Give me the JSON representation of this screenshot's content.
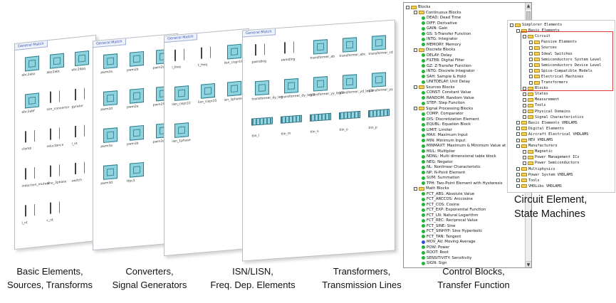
{
  "panels": [
    {
      "tab": "General Match",
      "labels": [
        "abc2abz",
        "abz2abc",
        "ebc2dpq",
        "abc2abf",
        "sim_converter",
        "gyrator",
        "clamp",
        "reluctance",
        "l_nt",
        "induction_mutual",
        "sine_3phase",
        "switch",
        "l_nt",
        "c_nt"
      ]
    },
    {
      "tab": "General Match",
      "labels": [
        "pwm2a",
        "pwm2b",
        "pwm2c",
        "pwm2d",
        "pwm2e",
        "pwm2f",
        "pwm3a",
        "pwm3b",
        "pwm3c",
        "pwm3d",
        "tfpc3"
      ]
    },
    {
      "tab": "General Match",
      "labels": [
        "l_freq",
        "t_freq",
        "lisn_cispr16",
        "lisn_cispr22",
        "lisn_cispr25",
        "isn_3phase",
        "lisn_1phase"
      ]
    },
    {
      "tab": "General Match",
      "labels": [
        "pwinding",
        "swinding",
        "transformer_ab",
        "transformer_abc",
        "transformer_cd",
        "transformer_dy_leg",
        "transformer_dy_leg3l",
        "transformer_yy_leg3l",
        "transformer_yd_leg3l",
        "transformer_yy",
        "tlin_l",
        "tlin_m",
        "tlin_n",
        "tlin_o",
        "tlin_p"
      ]
    }
  ],
  "captions": [
    {
      "line1": "Basic Elements,",
      "line2": "Sources, Transforms"
    },
    {
      "line1": "Converters,",
      "line2": "Signal Generators"
    },
    {
      "line1": "ISN/LISN,",
      "line2": "Freq. Dep. Elements"
    },
    {
      "line1": "Transformers,",
      "line2": "Transmission Lines"
    },
    {
      "line1": "Control Blocks,",
      "line2": "Transfer Function"
    }
  ],
  "blocks_tree": [
    {
      "label": "Blocks",
      "level": 0,
      "kind": "folder"
    },
    {
      "label": "Continuous Blocks",
      "level": 1,
      "kind": "folder"
    },
    {
      "label": "DEAD: Dead Time",
      "level": 2,
      "kind": "item"
    },
    {
      "label": "DIFF: Derivative",
      "level": 2,
      "kind": "item"
    },
    {
      "label": "GAIN: Gain",
      "level": 2,
      "kind": "item"
    },
    {
      "label": "GS: S-Transfer Function",
      "level": 2,
      "kind": "item"
    },
    {
      "label": "INTG: Integrator",
      "level": 2,
      "kind": "item"
    },
    {
      "label": "MEMORY: Memory",
      "level": 2,
      "kind": "item"
    },
    {
      "label": "Discrete Blocks",
      "level": 1,
      "kind": "folder"
    },
    {
      "label": "DELAY: Delay",
      "level": 2,
      "kind": "item"
    },
    {
      "label": "FILTER: Digital Filter",
      "level": 2,
      "kind": "item"
    },
    {
      "label": "GZ: Z-Transfer Function",
      "level": 2,
      "kind": "item"
    },
    {
      "label": "INTG: Discrete Integrator",
      "level": 2,
      "kind": "item"
    },
    {
      "label": "SAH: Sample & Hold",
      "level": 2,
      "kind": "item"
    },
    {
      "label": "UNITDELAY: Unit Delay",
      "level": 2,
      "kind": "item"
    },
    {
      "label": "Sources Blocks",
      "level": 1,
      "kind": "folder"
    },
    {
      "label": "CONST: Constant Value",
      "level": 2,
      "kind": "item"
    },
    {
      "label": "RANDOM: Random Value",
      "level": 2,
      "kind": "item"
    },
    {
      "label": "STEP: Step Function",
      "level": 2,
      "kind": "item"
    },
    {
      "label": "Signal Processing Blocks",
      "level": 1,
      "kind": "folder"
    },
    {
      "label": "COMP: Comparator",
      "level": 2,
      "kind": "item"
    },
    {
      "label": "DIS: Discretization Element",
      "level": 2,
      "kind": "item"
    },
    {
      "label": "EQUBL: Equation Block",
      "level": 2,
      "kind": "item"
    },
    {
      "label": "LIMIT: Limiter",
      "level": 2,
      "kind": "item"
    },
    {
      "label": "MAX: Maximum Input",
      "level": 2,
      "kind": "item"
    },
    {
      "label": "MIN: Minimum Input",
      "level": 2,
      "kind": "item"
    },
    {
      "label": "MINMAXT: Maximum & Minimum Value at Time",
      "level": 2,
      "kind": "item"
    },
    {
      "label": "MUL: Multiplier",
      "level": 2,
      "kind": "item"
    },
    {
      "label": "NDNL: Multi dimensional table block",
      "level": 2,
      "kind": "item"
    },
    {
      "label": "NEG: Negator",
      "level": 2,
      "kind": "item"
    },
    {
      "label": "NL: Nonlinear Characteristic",
      "level": 2,
      "kind": "item"
    },
    {
      "label": "NP: N-Point Element",
      "level": 2,
      "kind": "item"
    },
    {
      "label": "SUM: Summation",
      "level": 2,
      "kind": "item"
    },
    {
      "label": "TPH: Two-Point Element with Hysteresis",
      "level": 2,
      "kind": "item"
    },
    {
      "label": "Math Blocks",
      "level": 1,
      "kind": "folder"
    },
    {
      "label": "FCT_ABS: Absolute Value",
      "level": 2,
      "kind": "item"
    },
    {
      "label": "FCT_ARCCOS: Arccosine",
      "level": 2,
      "kind": "item"
    },
    {
      "label": "FCT_COS: Cosine",
      "level": 2,
      "kind": "item"
    },
    {
      "label": "FCT_EXP: Exponential Function",
      "level": 2,
      "kind": "item"
    },
    {
      "label": "FCT_LN: Natural Logarithm",
      "level": 2,
      "kind": "item"
    },
    {
      "label": "FCT_REC: Reciprocal Value",
      "level": 2,
      "kind": "item"
    },
    {
      "label": "FCT_SINE: Sine",
      "level": 2,
      "kind": "item"
    },
    {
      "label": "FCT_SINHYP: Sine Hyperbolic",
      "level": 2,
      "kind": "item"
    },
    {
      "label": "FCT_TAN: Tangent",
      "level": 2,
      "kind": "item"
    },
    {
      "label": "MOV_AV: Moving Average",
      "level": 2,
      "kind": "item-blue"
    },
    {
      "label": "POW: Power",
      "level": 2,
      "kind": "item"
    },
    {
      "label": "ROOT: Root",
      "level": 2,
      "kind": "item"
    },
    {
      "label": "SENSITIVITY: Sensitivity",
      "level": 2,
      "kind": "item"
    },
    {
      "label": "SIGN: Sign",
      "level": 2,
      "kind": "item"
    }
  ],
  "elements_tree": [
    {
      "label": "Simplorer Elements",
      "level": 0
    },
    {
      "label": "Basic Elements",
      "level": 1
    },
    {
      "label": "Circuit",
      "level": 2
    },
    {
      "label": "Passive Elements",
      "level": 3
    },
    {
      "label": "Sources",
      "level": 3
    },
    {
      "label": "Ideal Switches",
      "level": 3
    },
    {
      "label": "Semiconductors System Level",
      "level": 3
    },
    {
      "label": "Semiconductors Device Level",
      "level": 3
    },
    {
      "label": "Spice-Compatible Models",
      "level": 3
    },
    {
      "label": "Electrical Machines",
      "level": 3
    },
    {
      "label": "Transformers",
      "level": 3
    },
    {
      "label": "Blocks",
      "level": 2
    },
    {
      "label": "States",
      "level": 2
    },
    {
      "label": "Measurement",
      "level": 2
    },
    {
      "label": "Tools",
      "level": 2
    },
    {
      "label": "Physical Domains",
      "level": 2
    },
    {
      "label": "Signal Characteristics",
      "level": 2
    },
    {
      "label": "Basic Elements VHDLAMS",
      "level": 1
    },
    {
      "label": "Digital Elements",
      "level": 1
    },
    {
      "label": "Aircraft Electrical VHDLAMS",
      "level": 1
    },
    {
      "label": "HEV VHDLAMS",
      "level": 1
    },
    {
      "label": "Manufacturers",
      "level": 1
    },
    {
      "label": "Magnetic",
      "level": 2
    },
    {
      "label": "Power Management ICs",
      "level": 2
    },
    {
      "label": "Power Semiconductors",
      "level": 2
    },
    {
      "label": "Multiphysics",
      "level": 1
    },
    {
      "label": "Power System VHDLAMS",
      "level": 1
    },
    {
      "label": "Tools",
      "level": 1
    },
    {
      "label": "VHDLibs VHDLAMS",
      "level": 1
    }
  ],
  "side_caption": {
    "line1": "Circuit Element,",
    "line2": "State Machines"
  },
  "colors": {
    "accent_red": "#e03c3c",
    "block_fill": "#8fd3df",
    "item_green": "#22b53a",
    "item_blue": "#2f4fd8"
  }
}
